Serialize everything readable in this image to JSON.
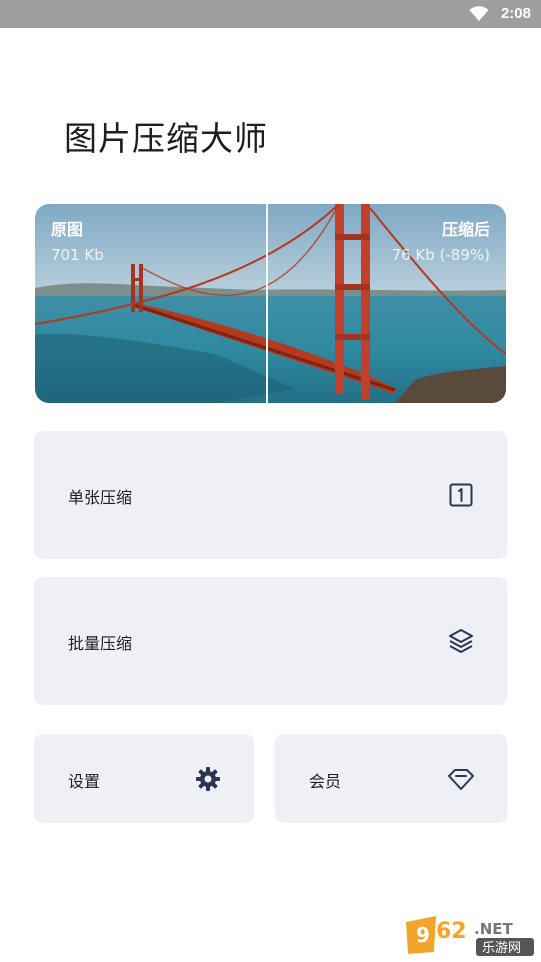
{
  "status_bar": {
    "time": "2:08"
  },
  "app": {
    "title": "图片压缩大师"
  },
  "comparison": {
    "original_label": "原图",
    "original_size": "701 Kb",
    "compressed_label": "压缩后",
    "compressed_size": "76 Kb (-89%)"
  },
  "menu": {
    "single": {
      "label": "单张压缩",
      "icon": "single-image-icon"
    },
    "batch": {
      "label": "批量压缩",
      "icon": "layers-icon"
    },
    "settings": {
      "label": "设置",
      "icon": "gear-icon"
    },
    "vip": {
      "label": "会员",
      "icon": "diamond-icon"
    }
  },
  "watermark": {
    "text_top": "962.NET",
    "text_bottom": "乐游网"
  },
  "colors": {
    "card_bg": "#eff0f6",
    "icon": "#2b3556",
    "status_bar": "#9e9e9e"
  }
}
